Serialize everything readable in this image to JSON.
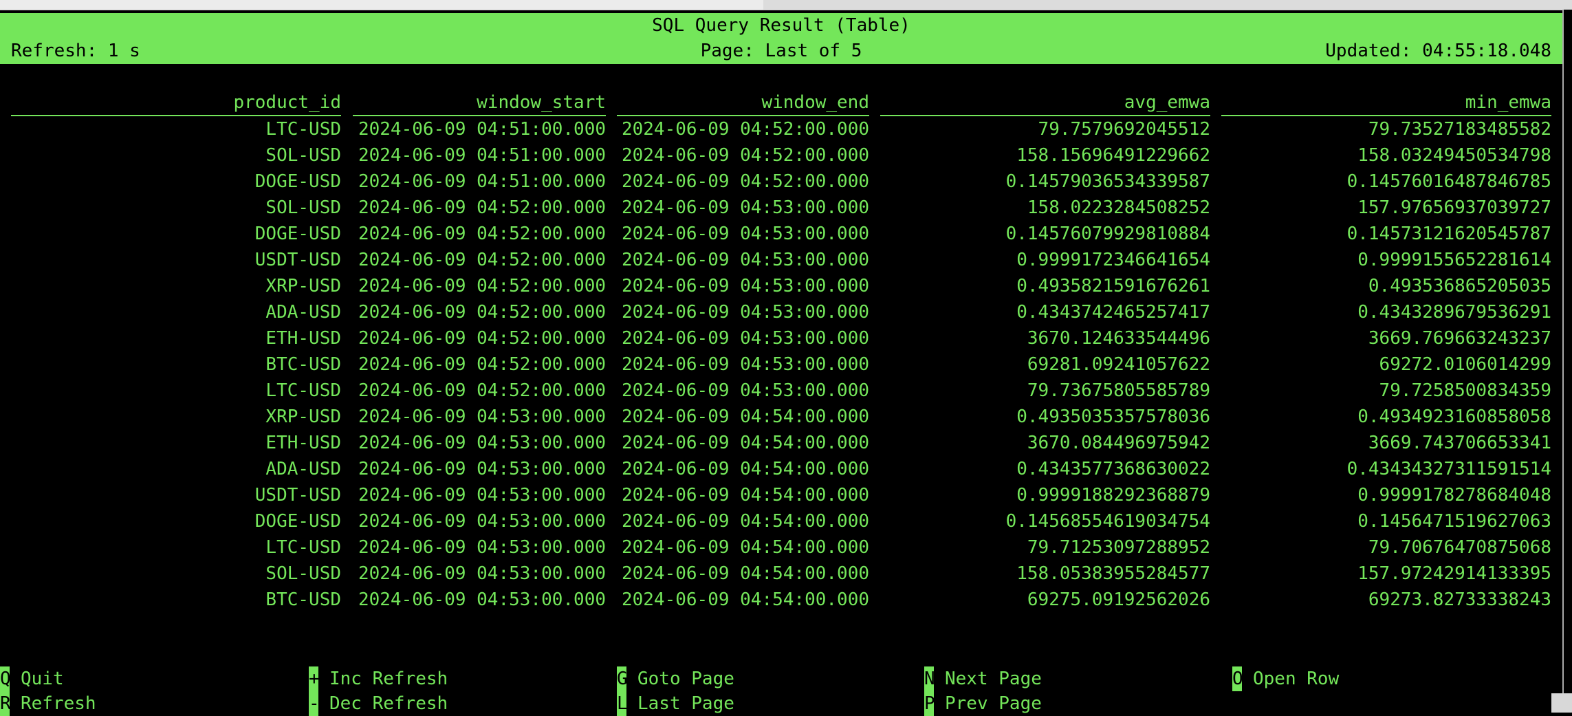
{
  "header": {
    "title": "SQL Query Result (Table)",
    "refresh": "Refresh: 1 s",
    "page": "Page: Last of 5",
    "updated": "Updated: 04:55:18.048"
  },
  "columns": [
    "product_id",
    "window_start",
    "window_end",
    "avg_emwa",
    "min_emwa"
  ],
  "rows": [
    [
      "LTC-USD",
      "2024-06-09 04:51:00.000",
      "2024-06-09 04:52:00.000",
      "79.7579692045512",
      "79.73527183485582"
    ],
    [
      "SOL-USD",
      "2024-06-09 04:51:00.000",
      "2024-06-09 04:52:00.000",
      "158.15696491229662",
      "158.03249450534798"
    ],
    [
      "DOGE-USD",
      "2024-06-09 04:51:00.000",
      "2024-06-09 04:52:00.000",
      "0.14579036534339587",
      "0.14576016487846785"
    ],
    [
      "SOL-USD",
      "2024-06-09 04:52:00.000",
      "2024-06-09 04:53:00.000",
      "158.0223284508252",
      "157.97656937039727"
    ],
    [
      "DOGE-USD",
      "2024-06-09 04:52:00.000",
      "2024-06-09 04:53:00.000",
      "0.14576079929810884",
      "0.14573121620545787"
    ],
    [
      "USDT-USD",
      "2024-06-09 04:52:00.000",
      "2024-06-09 04:53:00.000",
      "0.9999172346641654",
      "0.9999155652281614"
    ],
    [
      "XRP-USD",
      "2024-06-09 04:52:00.000",
      "2024-06-09 04:53:00.000",
      "0.4935821591676261",
      "0.49353686520503​5"
    ],
    [
      "ADA-USD",
      "2024-06-09 04:52:00.000",
      "2024-06-09 04:53:00.000",
      "0.434374246525741​7",
      "0.4343289679536291"
    ],
    [
      "ETH-USD",
      "2024-06-09 04:52:00.000",
      "2024-06-09 04:53:00.000",
      "3670.124633544496",
      "3669.769663243237"
    ],
    [
      "BTC-USD",
      "2024-06-09 04:52:00.000",
      "2024-06-09 04:53:00.000",
      "69281.09241057622",
      "69272.0106014299"
    ],
    [
      "LTC-USD",
      "2024-06-09 04:52:00.000",
      "2024-06-09 04:53:00.000",
      "79.73675805585789",
      "79.7258500834359"
    ],
    [
      "XRP-USD",
      "2024-06-09 04:53:00.000",
      "2024-06-09 04:54:00.000",
      "0.4935035357578036",
      "0.4934923160858058"
    ],
    [
      "ETH-USD",
      "2024-06-09 04:53:00.000",
      "2024-06-09 04:54:00.000",
      "3670.084496975942",
      "3669.743706653341"
    ],
    [
      "ADA-USD",
      "2024-06-09 04:53:00.000",
      "2024-06-09 04:54:00.000",
      "0.4343577368630022",
      "0.43434327311591514"
    ],
    [
      "USDT-USD",
      "2024-06-09 04:53:00.000",
      "2024-06-09 04:54:00.000",
      "0.9999188292368879",
      "0.9999178278684048"
    ],
    [
      "DOGE-USD",
      "2024-06-09 04:53:00.000",
      "2024-06-09 04:54:00.000",
      "0.14568554619034754",
      "0.145647151962706​3"
    ],
    [
      "LTC-USD",
      "2024-06-09 04:53:00.000",
      "2024-06-09 04:54:00.000",
      "79.71253097288952",
      "79.70676470875068"
    ],
    [
      "SOL-USD",
      "2024-06-09 04:53:00.000",
      "2024-06-09 04:54:00.000",
      "158.05383955284577",
      "157.97242914133395"
    ],
    [
      "BTC-USD",
      "2024-06-09 04:53:00.000",
      "2024-06-09 04:54:00.000",
      "69275.09192562026",
      "69273.82733338243"
    ]
  ],
  "footer": [
    {
      "key": "Q",
      "label": "Quit"
    },
    {
      "key": "R",
      "label": "Refresh"
    },
    {
      "key": "+",
      "label": "Inc Refresh"
    },
    {
      "key": "-",
      "label": "Dec Refresh"
    },
    {
      "key": "G",
      "label": "Goto Page"
    },
    {
      "key": "L",
      "label": "Last Page"
    },
    {
      "key": "N",
      "label": "Next Page"
    },
    {
      "key": "P",
      "label": "Prev Page"
    },
    {
      "key": "O",
      "label": "Open Row"
    }
  ]
}
